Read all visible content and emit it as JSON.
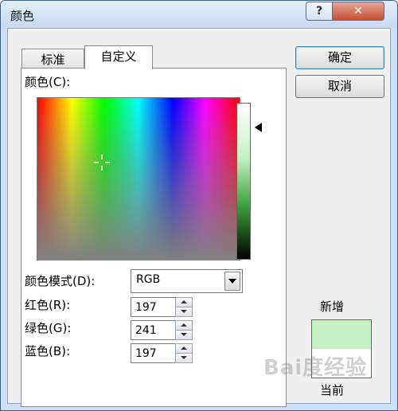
{
  "window": {
    "title": "颜色",
    "help_glyph": "?",
    "close_glyph": "✕"
  },
  "tabs": [
    {
      "label": "标准",
      "active": false
    },
    {
      "label": "自定义",
      "active": true
    }
  ],
  "custom": {
    "colors_label": "颜色(C):",
    "mode_label": "颜色模式(D):",
    "mode_value": "RGB",
    "red_label": "红色(R):",
    "red_value": "197",
    "green_label": "绿色(G):",
    "green_value": "241",
    "blue_label": "蓝色(B):",
    "blue_value": "197"
  },
  "buttons": {
    "ok_label": "确定",
    "cancel_label": "取消"
  },
  "preview": {
    "new_label": "新增",
    "current_label": "当前",
    "new_color": "#c5f1c5",
    "current_color": "#ffffff"
  },
  "watermark": "Bai度经验",
  "colors": {
    "title_bar": "#c6daf1",
    "close_button": "#c54d34",
    "dialog_bg": "#f0f0f0"
  }
}
